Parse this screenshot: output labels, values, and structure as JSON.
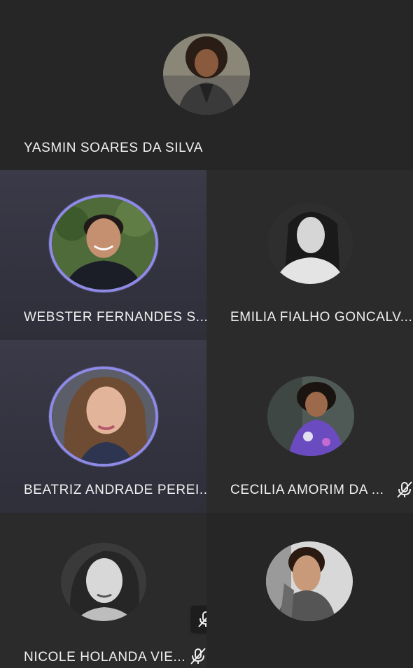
{
  "participants": [
    {
      "name": "YASMIN SOARES DA SILVA",
      "speaking": false,
      "muted": false,
      "avatar_icon": "person-photo-icon"
    },
    {
      "name": "WEBSTER FERNANDES S...",
      "speaking": true,
      "muted": false,
      "avatar_icon": "person-photo-icon"
    },
    {
      "name": "EMILIA FIALHO GONCALV...",
      "speaking": false,
      "muted": false,
      "avatar_icon": "person-photo-icon"
    },
    {
      "name": "BEATRIZ ANDRADE PEREI...",
      "speaking": true,
      "muted": false,
      "avatar_icon": "person-photo-icon"
    },
    {
      "name": "CECILIA AMORIM DA ...",
      "speaking": false,
      "muted": true,
      "avatar_icon": "person-photo-icon"
    },
    {
      "name": "NICOLE HOLANDA VIE...",
      "speaking": false,
      "muted": true,
      "avatar_icon": "person-photo-icon"
    },
    {
      "name": "",
      "speaking": false,
      "muted": false,
      "avatar_icon": "person-photo-icon"
    }
  ],
  "self_mic": {
    "muted": true,
    "icon": "mic-off-icon"
  },
  "colors": {
    "speaking_ring": "#8f8ae6",
    "tile_background": "#2b2b2b",
    "speaking_tile_background": "#353542",
    "text": "#f0f0f0"
  }
}
